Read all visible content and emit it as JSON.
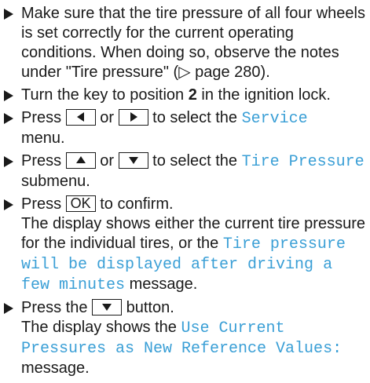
{
  "steps": [
    {
      "text": "Make sure that the tire pressure of all four wheels is set correctly for the current operating conditions. When doing so, observe the notes under \"Tire pressure\" (▷ page 280)."
    },
    {
      "text_before": "Turn the key to position ",
      "bold": "2",
      "text_after": " in the ignition lock."
    },
    {
      "press": "Press",
      "or": "or",
      "to_select": "to select the",
      "menu_name": "Service",
      "menu_word": "menu."
    },
    {
      "press": "Press",
      "or": "or",
      "to_select": "to select the",
      "submenu_name": "Tire Pressure",
      "submenu_word": "submenu."
    },
    {
      "press": "Press",
      "ok_label": "OK",
      "to_confirm": "to confirm.",
      "display_text": "The display shows either the current tire pressure for the individual tires, or the",
      "message": "Tire pressure will be displayed after driving a few minutes",
      "message_word": "message."
    },
    {
      "press": "Press the",
      "button_word": "button.",
      "display_text": "The display shows the",
      "message": "Use Current Pressures as New Reference Values:",
      "message_word": "message."
    }
  ],
  "icons": {
    "left": "left-arrow-icon",
    "right": "right-arrow-icon",
    "up": "up-arrow-icon",
    "down": "down-arrow-icon"
  },
  "colors": {
    "accent": "#3a9fd6",
    "text": "#1a1a1a"
  }
}
